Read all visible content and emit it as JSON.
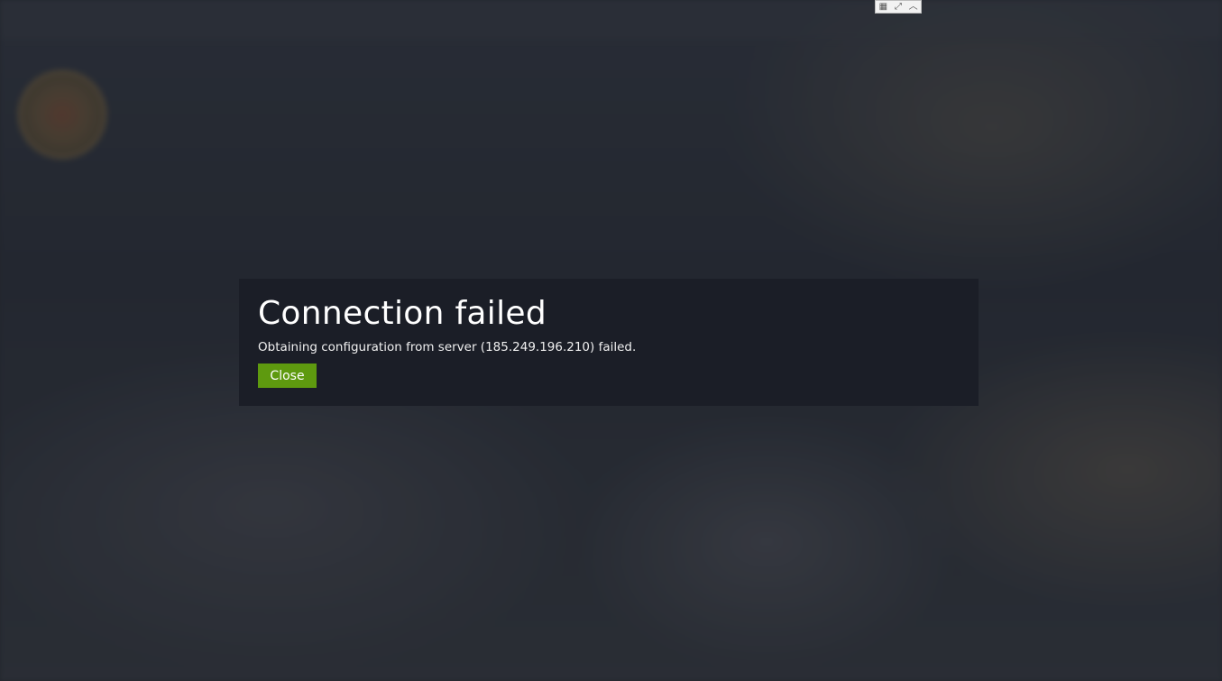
{
  "colors": {
    "modal_bg": "#1b1e27",
    "accent_green": "#5e9a0f",
    "text_white": "#ffffff"
  },
  "window_controls": {
    "icons": [
      "grid-icon",
      "expand-icon",
      "chevron-up-icon"
    ],
    "glyphs": [
      "▦",
      "⤢",
      "︿"
    ]
  },
  "modal": {
    "title": "Connection failed",
    "message": "Obtaining configuration from server (185.249.196.210) failed.",
    "close_label": "Close"
  }
}
